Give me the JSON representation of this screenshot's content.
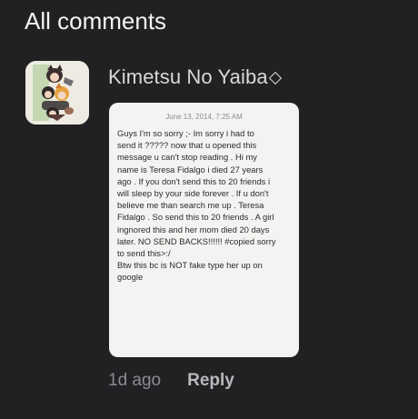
{
  "header": {
    "title": "All comments"
  },
  "comment": {
    "username": "Kimetsu No Yaiba",
    "badge_icon": "diamond-outline-icon",
    "avatar_icon": "anime-characters-avatar",
    "posted_image": {
      "timestamp": "June 13, 2014, 7:25 AM",
      "lines": [
        "Guys I'm so sorry ;- Im sorry i had to",
        "send it ????? now that u opened this",
        "message u can't stop reading . Hi my",
        "name is Teresa Fidalgo i died 27 years",
        "ago . If you don't send this to 20 friends i",
        "will sleep by your side forever . If u don't",
        "believe me than search me up . Teresa",
        "Fidalgo . So send this to 20 friends . A girl",
        "ingnored this and her mom died 20 days",
        "later. NO SEND BACKS!!!!!! #copied sorry",
        "to send this>:/",
        "Btw this bc is NOT fake type her up on",
        "google"
      ]
    },
    "time_ago": "1d ago",
    "reply_label": "Reply"
  },
  "colors": {
    "background": "#212124",
    "card": "#f4f3f1",
    "username": "#d9d9d9",
    "muted": "#8c8c90"
  }
}
